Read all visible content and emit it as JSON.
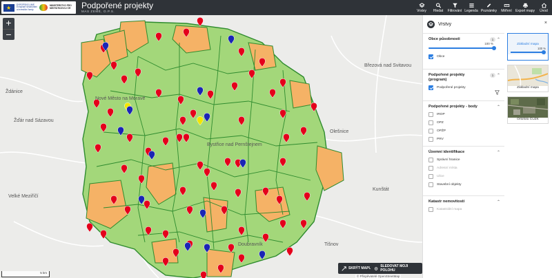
{
  "header": {
    "eu_text": "EVROPSKÁ UNIE Evropské strukturální a investiční fondy",
    "mmr_text": "MINISTERSTVO PRO MÍSTNÍ ROZVOJ ČR",
    "title": "Podpořené projekty",
    "subtitle": "MAS ZEMĚ, O.P.S."
  },
  "toolbar": [
    {
      "label": "Vrstvy",
      "icon": "layers-icon"
    },
    {
      "label": "Hledat",
      "icon": "search-icon"
    },
    {
      "label": "Filtrování",
      "icon": "filter-icon"
    },
    {
      "label": "Legenda",
      "icon": "legend-icon"
    },
    {
      "label": "Poznámky",
      "icon": "notes-icon"
    },
    {
      "label": "Měření",
      "icon": "measure-icon"
    },
    {
      "label": "Export mapy",
      "icon": "print-icon"
    },
    {
      "label": "Úvod",
      "icon": "home-icon"
    }
  ],
  "map": {
    "zoom_in": "+",
    "zoom_out": "−",
    "places": [
      {
        "name": "Ždánice",
        "cls": "p1"
      },
      {
        "name": "Žďár nad Sázavou",
        "cls": "p2"
      },
      {
        "name": "Nové Město na Moravě",
        "cls": "p3"
      },
      {
        "name": "Březová nad Svitavou",
        "cls": "p4"
      },
      {
        "name": "Olešnice",
        "cls": "p5"
      },
      {
        "name": "Kunštát",
        "cls": "p6"
      },
      {
        "name": "Tišnov",
        "cls": "p7"
      },
      {
        "name": "Velké Meziříčí",
        "cls": "p8"
      },
      {
        "name": "Bystřice nad Pernštejnem",
        "cls": "p9"
      },
      {
        "name": "Doubravník",
        "cls": "p10"
      }
    ],
    "btn_full": "SKRÝT MAPU",
    "btn_track": "SLEDOVAT MOJI POLOHU",
    "attribution": "© Přispěvatelé OpenStreetMap",
    "scale": "5 km",
    "colors": {
      "region": "#a3d77a",
      "orange": "#f5b266",
      "border": "#2e8b2e",
      "pin_red": "#e4001b",
      "pin_blue": "#1a25b5",
      "pin_yellow": "#f2e600"
    }
  },
  "panel": {
    "title": "Vrstvy",
    "close": "×",
    "groups": {
      "obce": {
        "title": "Obce působnosti",
        "count": "1",
        "opacity": "100 %",
        "item": "Obce"
      },
      "program": {
        "title": "Podpořené projekty (program)",
        "count": "1",
        "item": "Podpořené projekty"
      },
      "body": {
        "title": "Podpořené projekty - body",
        "items": [
          "IROP",
          "OPZ",
          "OPŽP",
          "PRV"
        ]
      },
      "uzemni": {
        "title": "Územní identifikace",
        "items": [
          "Správní hranice",
          "Adresní místa",
          "Ulice",
          "Stavební objekty"
        ]
      },
      "katastr": {
        "title": "Katastr nemovitostí",
        "items": [
          "Katastrální mapa"
        ]
      }
    },
    "basemaps": [
      {
        "label": "Základní mapa",
        "opacity": "100 %"
      },
      {
        "label": "Základní mapa"
      },
      {
        "label": "Ortofoto ČÚZK"
      }
    ]
  }
}
